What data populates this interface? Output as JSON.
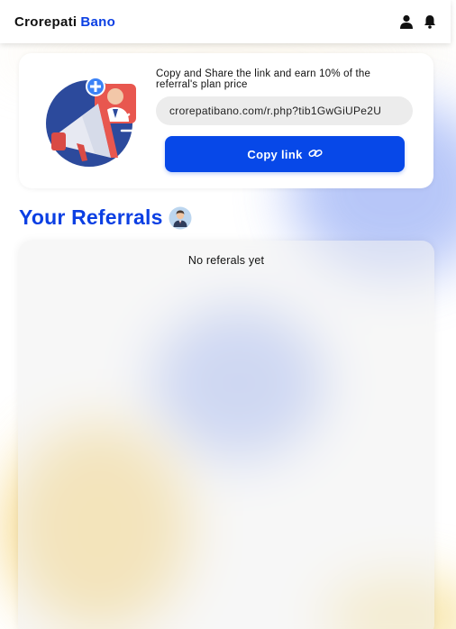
{
  "header": {
    "brand_part1": "Crorepati",
    "brand_part2": "Bano",
    "icons": [
      "user-icon",
      "bell-icon"
    ]
  },
  "share_card": {
    "description": "Copy and Share the link and earn 10% of the referral's plan price",
    "referral_link": "crorepatibano.com/r.php?tib1GwGiUPe2U",
    "copy_button_label": "Copy link",
    "copy_button_icon": "link-icon",
    "illustration": "megaphone-referral-illustration"
  },
  "referrals": {
    "title": "Your Referrals",
    "title_icon": "avatar-icon",
    "empty_message": "No referals yet"
  },
  "colors": {
    "accent": "#0b3fe3",
    "button": "#0748e8",
    "field_bg": "#ececec"
  }
}
